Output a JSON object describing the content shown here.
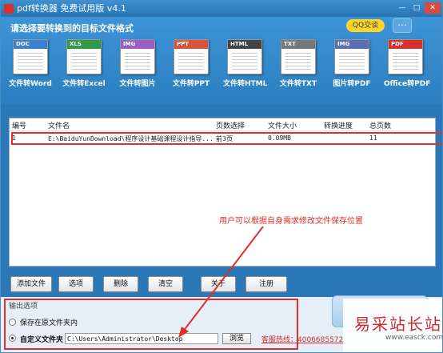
{
  "window": {
    "title": "pdf转换器 免费试用版 v4.1",
    "controls": [
      "—",
      "□",
      "✕"
    ]
  },
  "header": {
    "prompt": "请选择要转换到的目标文件格式",
    "qq_button": "QQ交谈"
  },
  "converters": [
    {
      "tag": "DOC",
      "label": "文件转Word",
      "color": "#3a7fd0"
    },
    {
      "tag": "XLS",
      "label": "文件转Excel",
      "color": "#2e9a45"
    },
    {
      "tag": "IMG",
      "label": "文件转图片",
      "color": "#9a5fc7"
    },
    {
      "tag": "PPT",
      "label": "文件转PPT",
      "color": "#d9533a"
    },
    {
      "tag": "HTML",
      "label": "文件转HTML",
      "color": "#444444"
    },
    {
      "tag": "TXT",
      "label": "文件转TXT",
      "color": "#777777"
    },
    {
      "tag": "IMG",
      "label": "图片转PDF",
      "color": "#5a6fb0"
    },
    {
      "tag": "PDF",
      "label": "Office转PDF",
      "color": "#d9302c"
    }
  ],
  "file_list": {
    "columns": [
      "编号",
      "文件名",
      "页数选择",
      "文件大小",
      "转换进度",
      "总页数"
    ],
    "rows": [
      {
        "num": "1",
        "name": "E:\\BaiduYunDownload\\程序设计基础课程设计指导...",
        "pages": "前3页",
        "size": "0.09MB",
        "progress": "",
        "total": "11"
      }
    ]
  },
  "annotation": "用户可以根据自身需求修改文件保存位置",
  "buttons": [
    "添加文件",
    "选项",
    "删除",
    "清空",
    "关于",
    "注册"
  ],
  "output": {
    "title": "输出选项",
    "option1": "保存在原文件夹内",
    "option2": "自定义文件夹",
    "path": "C:\\Users\\Administrator\\Desktop",
    "browse": "浏览",
    "hotline": "客服热线：4006685572"
  },
  "watermark": {
    "main": "易采站长站",
    "url": "www.easck.com"
  }
}
